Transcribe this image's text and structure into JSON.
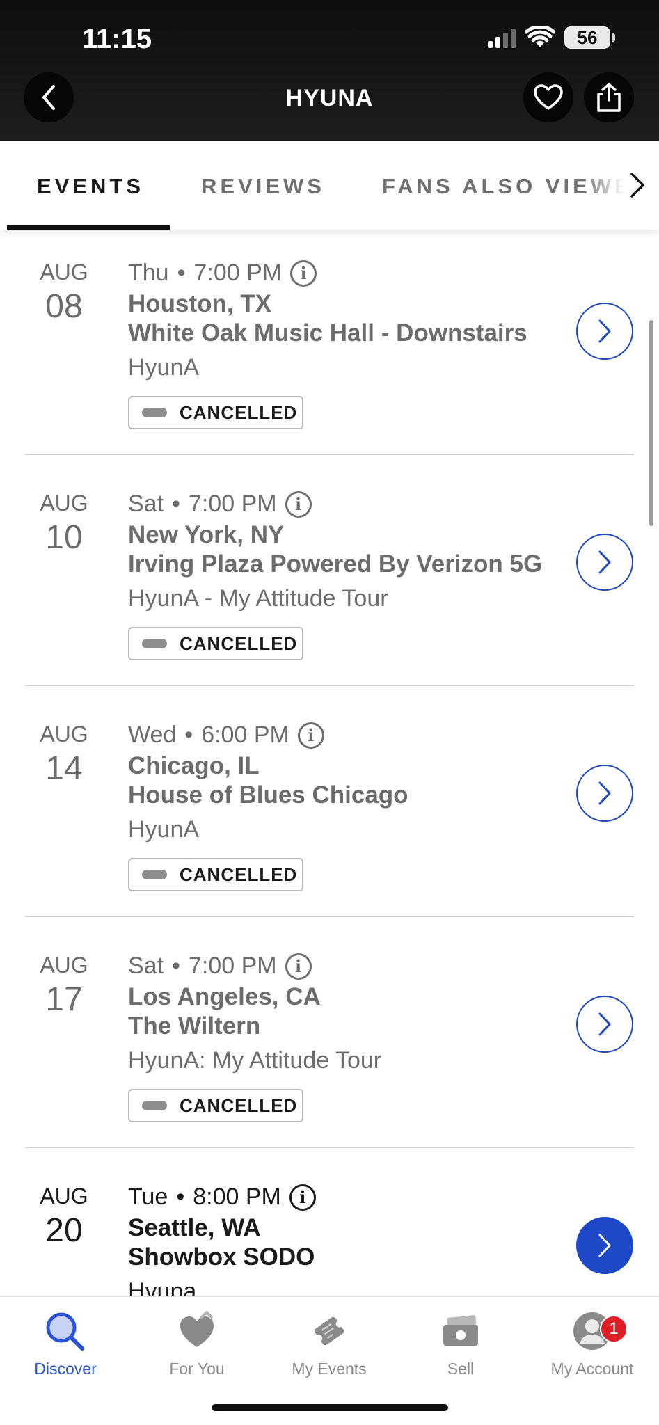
{
  "status_bar": {
    "time": "11:15",
    "battery": "56"
  },
  "header": {
    "title": "HYUNA"
  },
  "tabs": [
    {
      "label": "EVENTS",
      "active": true
    },
    {
      "label": "REVIEWS",
      "active": false
    },
    {
      "label": "FANS ALSO VIEWED",
      "active": false
    }
  ],
  "events": [
    {
      "month": "AUG",
      "day": "08",
      "weekday": "Thu",
      "time": "7:00 PM",
      "city": "Houston, TX",
      "venue": "White Oak Music Hall - Downstairs",
      "name": "HyunA",
      "status": "CANCELLED"
    },
    {
      "month": "AUG",
      "day": "10",
      "weekday": "Sat",
      "time": "7:00 PM",
      "city": "New York, NY",
      "venue": "Irving Plaza Powered By Verizon 5G",
      "name": "HyunA - My Attitude Tour",
      "status": "CANCELLED"
    },
    {
      "month": "AUG",
      "day": "14",
      "weekday": "Wed",
      "time": "6:00 PM",
      "city": "Chicago, IL",
      "venue": "House of Blues Chicago",
      "name": "HyunA",
      "status": "CANCELLED"
    },
    {
      "month": "AUG",
      "day": "17",
      "weekday": "Sat",
      "time": "7:00 PM",
      "city": "Los Angeles, CA",
      "venue": "The Wiltern",
      "name": "HyunA: My Attitude Tour",
      "status": "CANCELLED"
    },
    {
      "month": "AUG",
      "day": "20",
      "weekday": "Tue",
      "time": "8:00 PM",
      "city": "Seattle, WA",
      "venue": "Showbox SODO",
      "name": "Hyuna",
      "status": ""
    }
  ],
  "bottom_nav": [
    {
      "label": "Discover",
      "icon": "search-icon",
      "active": true
    },
    {
      "label": "For You",
      "icon": "heart-icon",
      "active": false
    },
    {
      "label": "My Events",
      "icon": "ticket-icon",
      "active": false
    },
    {
      "label": "Sell",
      "icon": "cash-icon",
      "active": false
    },
    {
      "label": "My Account",
      "icon": "account-icon",
      "active": false,
      "badge": "1"
    }
  ],
  "colors": {
    "accent": "#1f48c9",
    "header_bg": "#111111",
    "badge": "#e01e26"
  }
}
